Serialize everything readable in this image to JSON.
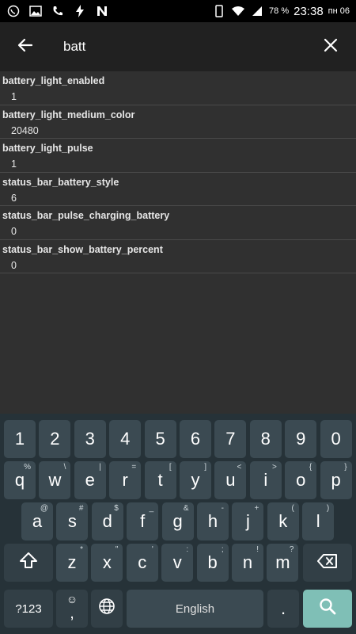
{
  "status_bar": {
    "battery": "78 %",
    "time": "23:38",
    "day": "пн 06"
  },
  "search": {
    "query": "batt"
  },
  "results": [
    {
      "key": "battery_light_enabled",
      "value": "1"
    },
    {
      "key": "battery_light_medium_color",
      "value": "20480"
    },
    {
      "key": "battery_light_pulse",
      "value": "1"
    },
    {
      "key": "status_bar_battery_style",
      "value": "6"
    },
    {
      "key": "status_bar_pulse_charging_battery",
      "value": "0"
    },
    {
      "key": "status_bar_show_battery_percent",
      "value": "0"
    }
  ],
  "keyboard": {
    "numbers": [
      "1",
      "2",
      "3",
      "4",
      "5",
      "6",
      "7",
      "8",
      "9",
      "0"
    ],
    "row1": [
      {
        "label": "q",
        "hint": "%"
      },
      {
        "label": "w",
        "hint": "\\"
      },
      {
        "label": "e",
        "hint": "|"
      },
      {
        "label": "r",
        "hint": "="
      },
      {
        "label": "t",
        "hint": "["
      },
      {
        "label": "y",
        "hint": "]"
      },
      {
        "label": "u",
        "hint": "<"
      },
      {
        "label": "i",
        "hint": ">"
      },
      {
        "label": "o",
        "hint": "{"
      },
      {
        "label": "p",
        "hint": "}"
      }
    ],
    "row2": [
      {
        "label": "a",
        "hint": "@"
      },
      {
        "label": "s",
        "hint": "#"
      },
      {
        "label": "d",
        "hint": "$"
      },
      {
        "label": "f",
        "hint": "_"
      },
      {
        "label": "g",
        "hint": "&"
      },
      {
        "label": "h",
        "hint": "-"
      },
      {
        "label": "j",
        "hint": "+"
      },
      {
        "label": "k",
        "hint": "("
      },
      {
        "label": "l",
        "hint": ")"
      }
    ],
    "row3": [
      {
        "label": "z",
        "hint": "*"
      },
      {
        "label": "x",
        "hint": "\""
      },
      {
        "label": "c",
        "hint": "'"
      },
      {
        "label": "v",
        "hint": ":"
      },
      {
        "label": "b",
        "hint": ";"
      },
      {
        "label": "n",
        "hint": "!"
      },
      {
        "label": "m",
        "hint": "?"
      }
    ],
    "symbols_label": "?123",
    "emoji_comma": ",",
    "space_label": "English",
    "period_label": "."
  }
}
